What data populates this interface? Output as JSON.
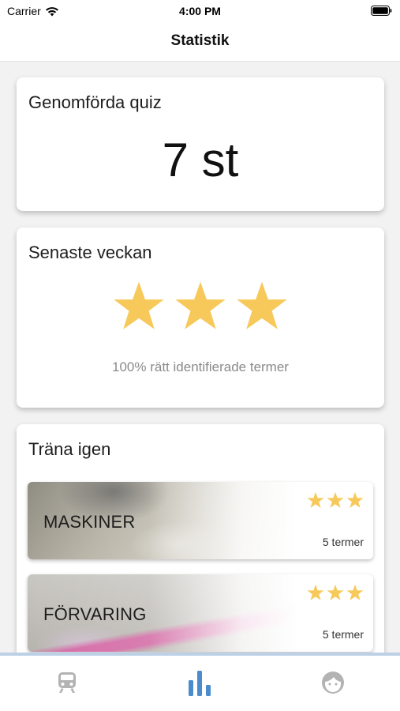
{
  "status_bar": {
    "carrier": "Carrier",
    "time": "4:00 PM"
  },
  "header": {
    "title": "Statistik"
  },
  "quiz_card": {
    "title": "Genomförda quiz",
    "count": "7 st"
  },
  "week_card": {
    "title": "Senaste veckan",
    "stars_filled": 3,
    "stars_total": 3,
    "caption": "100% rätt identifierade termer"
  },
  "train_card": {
    "title": "Träna igen",
    "items": [
      {
        "name": "MASKINER",
        "terms": "5 termer",
        "stars": 3
      },
      {
        "name": "FÖRVARING",
        "terms": "5 termer",
        "stars": 3
      }
    ]
  },
  "tab_bar": {
    "tabs": [
      {
        "icon": "train-icon",
        "active": false
      },
      {
        "icon": "bar-chart-icon",
        "active": true
      },
      {
        "icon": "face-icon",
        "active": false
      }
    ],
    "active_color": "#4a8ccc",
    "inactive_color": "#b3b3b3",
    "star_color": "#f7c95a"
  }
}
